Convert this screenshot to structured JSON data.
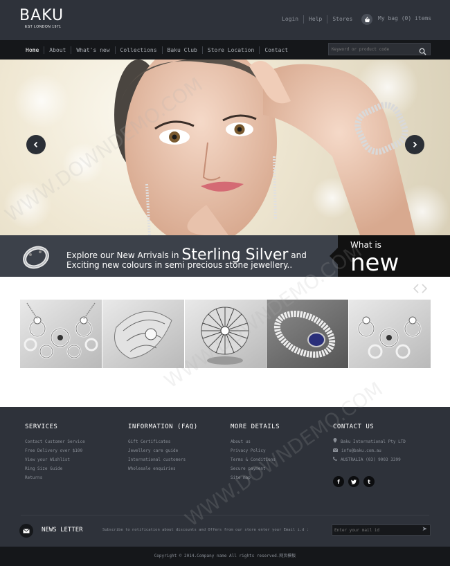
{
  "brand": {
    "name": "BAKU",
    "tagline": "EST LONDON 1971"
  },
  "top_links": [
    "Login",
    "Help",
    "Stores"
  ],
  "bag": {
    "label": "My bag (0) items"
  },
  "nav": {
    "items": [
      "Home",
      "About",
      "What's new",
      "Collections",
      "Baku Club",
      "Store Location",
      "Contact"
    ],
    "active": "Home"
  },
  "search": {
    "placeholder": "Keyword or product code"
  },
  "promo": {
    "line1_prefix": "Explore our New Arrivals in",
    "line1_highlight": "Sterling Silver",
    "line1_suffix": "and",
    "line2": "Exciting new colours in semi precious stone jewellery..",
    "badge_small": "What is",
    "badge_big": "new"
  },
  "footer": {
    "services": {
      "title": "SERVICES",
      "items": [
        "Contact Customer Service",
        "Free Delivery over $100",
        "View your Wishlist",
        "Ring Size Guide",
        "Returns"
      ]
    },
    "info": {
      "title": "INFORMATION (FAQ)",
      "items": [
        "Gift Certificates",
        "Jewellery care guide",
        "International customers",
        "Wholesale enquiries"
      ]
    },
    "more": {
      "title": "MORE DETAILS",
      "items": [
        "About us",
        "Privacy Policy",
        "Terms & Conditions",
        "Secure payment",
        "Site map"
      ]
    },
    "contact": {
      "title": "CONTACT US",
      "items": [
        "Baku International Pty LTD",
        "info@baku.com.au",
        "AUSTRALIA (03) 9003 3399"
      ]
    },
    "socials": [
      "f",
      "t",
      "t"
    ]
  },
  "newsletter": {
    "title": "NEWS LETTER",
    "text": "Subscribe to notification about discounts and Offers from our store enter your Email i.d :",
    "placeholder": "Enter your mail id"
  },
  "copyright": "Copyright © 2014.Company name All rights reserved.网页模板",
  "watermark": "WWW.DOWNDEMO.COM",
  "colors": {
    "header": "#2e323a",
    "nav": "#15171a",
    "promo": "#3c414a",
    "badge": "#111111"
  }
}
